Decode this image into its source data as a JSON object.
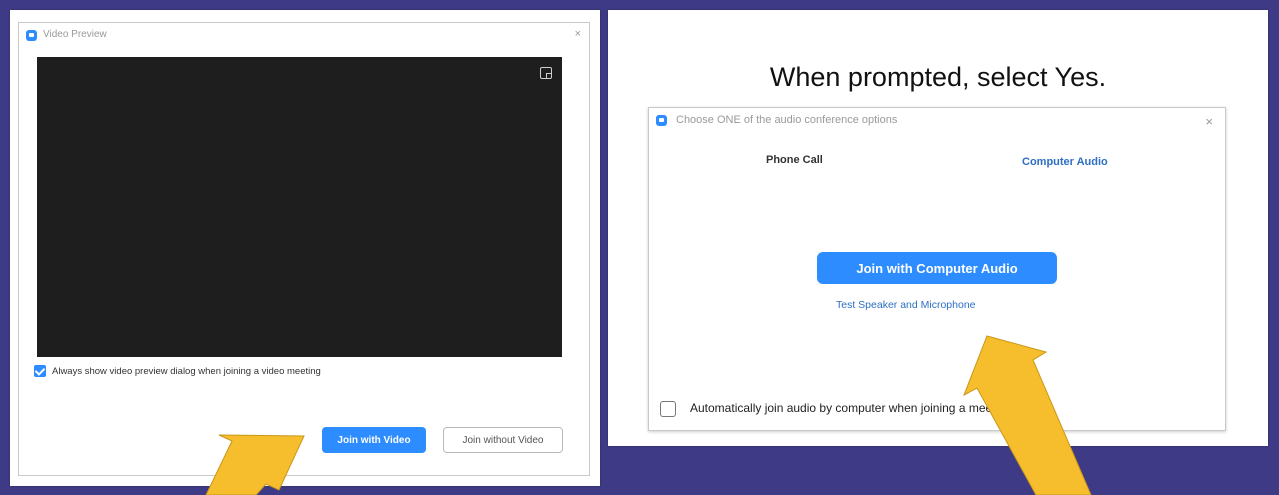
{
  "video_preview": {
    "title": "Video Preview",
    "close_glyph": "×",
    "always_show_label": "Always show video preview dialog when joining a video meeting",
    "always_show_checked": true,
    "join_with_video": "Join with Video",
    "join_without_video": "Join without Video"
  },
  "instruction": "When prompted, select Yes.",
  "audio_dialog": {
    "title": "Choose ONE of the audio conference options",
    "close_glyph": "×",
    "tabs": [
      "Phone Call",
      "Computer Audio"
    ],
    "active_tab": "Computer Audio",
    "join_audio": "Join with Computer Audio",
    "test_link": "Test Speaker and Microphone",
    "auto_join_label": "Automatically join audio by computer when joining a meeting",
    "auto_join_checked": false
  },
  "colors": {
    "background": "#3e3a86",
    "accent_blue": "#2d8cff",
    "arrow": "#f6be2c"
  },
  "icons": [
    "app-icon",
    "fullscreen-icon",
    "close-icon",
    "checkbox-icon",
    "arrow-icon"
  ]
}
